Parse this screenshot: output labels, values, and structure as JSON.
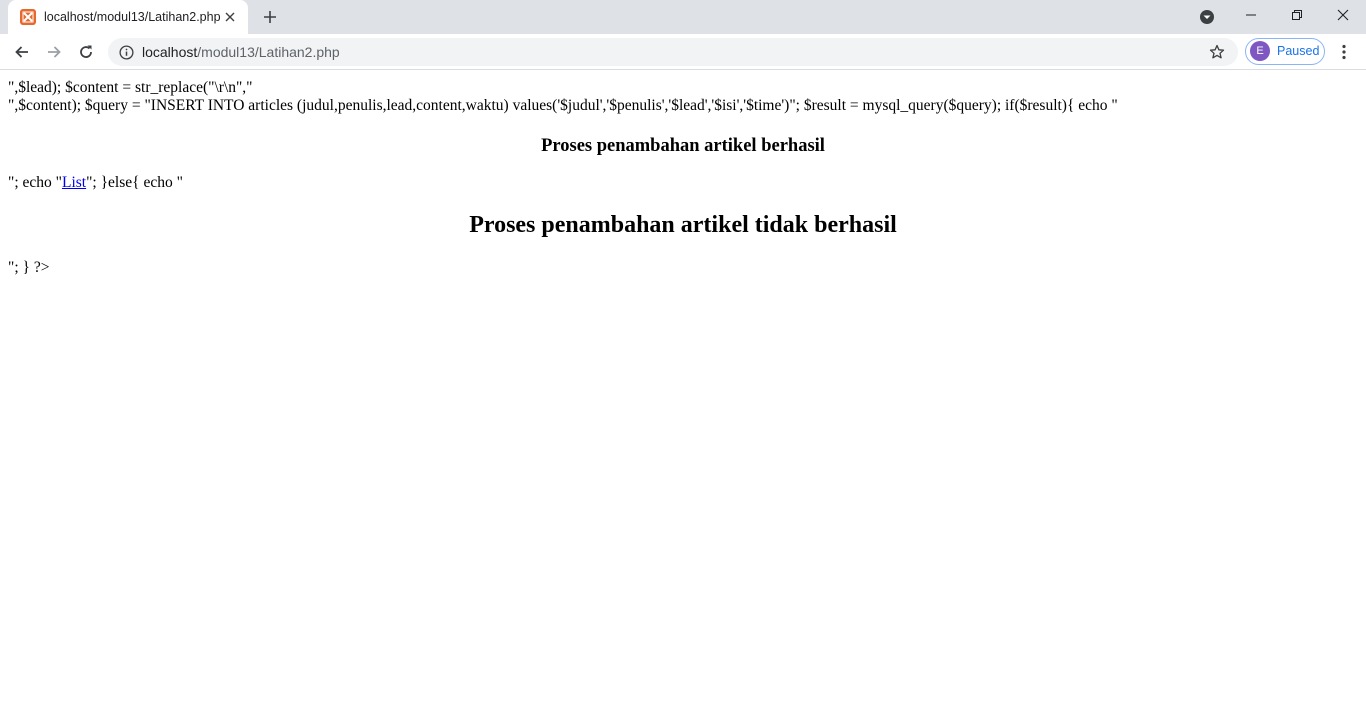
{
  "browser": {
    "tab": {
      "title": "localhost/modul13/Latihan2.php",
      "favicon": "xampp-icon"
    },
    "address": {
      "host": "localhost",
      "path": "/modul13/Latihan2.php"
    },
    "profile": {
      "initial": "E",
      "status": "Paused"
    },
    "colors": {
      "tabstrip": "#dee1e6",
      "omnibox": "#f1f3f4",
      "avatar": "#7e57c2",
      "accent": "#1a73e8"
    }
  },
  "page": {
    "line1": "\",$lead); $content = str_replace(\"\\r\\n\",\"",
    "line2": "\",$content); $query = \"INSERT INTO articles (judul,penulis,lead,content,waktu) values('$judul','$penulis','$lead','$isi','$time')\"; $result = mysql_query($query); if($result){ echo \"",
    "heading_success": "Proses penambahan artikel berhasil",
    "line3_before": "\"; echo \"",
    "line3_link": "List",
    "line3_after": "\"; }else{ echo \"",
    "heading_fail": "Proses penambahan artikel tidak berhasil",
    "line4": "\"; } ?>"
  }
}
